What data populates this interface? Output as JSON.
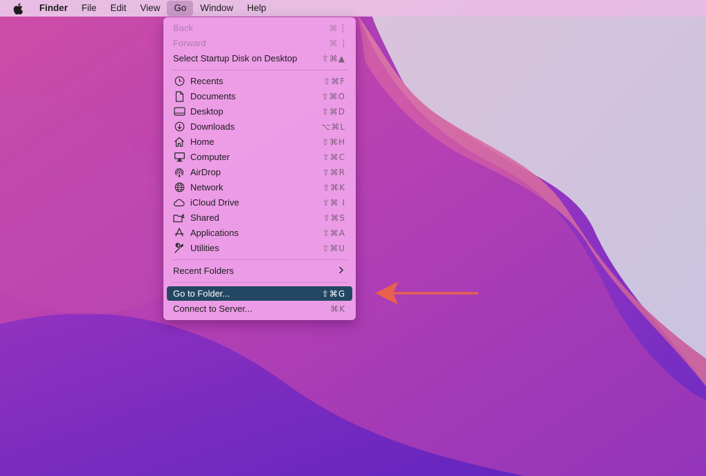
{
  "menubar": {
    "apple_icon": "apple-logo-icon",
    "items": [
      {
        "label": "Finder"
      },
      {
        "label": "File"
      },
      {
        "label": "Edit"
      },
      {
        "label": "View"
      },
      {
        "label": "Go"
      },
      {
        "label": "Window"
      },
      {
        "label": "Help"
      }
    ]
  },
  "go_menu": {
    "section1": [
      {
        "label": "Back",
        "shortcut": "⌘ [",
        "disabled": true
      },
      {
        "label": "Forward",
        "shortcut": "⌘ ]",
        "disabled": true
      },
      {
        "label": "Select Startup Disk on Desktop",
        "shortcut": "⇧⌘▲",
        "disabled": false
      }
    ],
    "places": [
      {
        "label": "Recents",
        "shortcut": "⇧⌘F",
        "icon": "clock-icon"
      },
      {
        "label": "Documents",
        "shortcut": "⇧⌘O",
        "icon": "document-icon"
      },
      {
        "label": "Desktop",
        "shortcut": "⇧⌘D",
        "icon": "desktop-icon"
      },
      {
        "label": "Downloads",
        "shortcut": "⌥⌘L",
        "icon": "download-icon"
      },
      {
        "label": "Home",
        "shortcut": "⇧⌘H",
        "icon": "home-icon"
      },
      {
        "label": "Computer",
        "shortcut": "⇧⌘C",
        "icon": "computer-icon"
      },
      {
        "label": "AirDrop",
        "shortcut": "⇧⌘R",
        "icon": "airdrop-icon"
      },
      {
        "label": "Network",
        "shortcut": "⇧⌘K",
        "icon": "globe-icon"
      },
      {
        "label": "iCloud Drive",
        "shortcut": "⇧⌘ I",
        "icon": "cloud-icon"
      },
      {
        "label": "Shared",
        "shortcut": "⇧⌘S",
        "icon": "shared-folder-icon"
      },
      {
        "label": "Applications",
        "shortcut": "⇧⌘A",
        "icon": "applications-icon"
      },
      {
        "label": "Utilities",
        "shortcut": "⇧⌘U",
        "icon": "utilities-icon"
      }
    ],
    "recent_folders": {
      "label": "Recent Folders",
      "icon": "chevron-right-icon"
    },
    "section4": [
      {
        "label": "Go to Folder...",
        "shortcut": "⇧⌘G",
        "selected": true
      },
      {
        "label": "Connect to Server...",
        "shortcut": "⌘K",
        "selected": false
      }
    ]
  },
  "annotation": {
    "icon": "red-arrow-icon",
    "color": "#e8604f"
  },
  "colors": {
    "selection": "#234763",
    "menu_bg": "#eea0e8",
    "menubar_bg": "#ecc8e8"
  }
}
